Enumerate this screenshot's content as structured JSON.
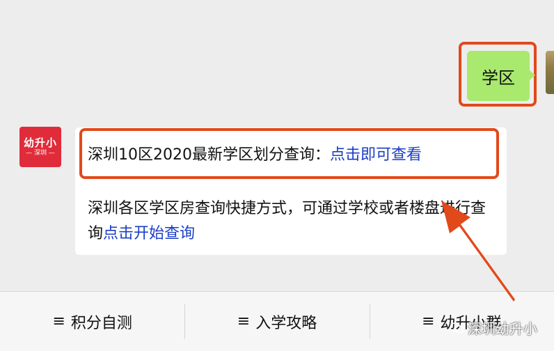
{
  "outgoing": {
    "text": "学区"
  },
  "incoming": {
    "avatar": {
      "logo_main": "幼升小",
      "logo_sub": "— 深圳 —"
    },
    "line1_text": "深圳10区2020最新学区划分查询：",
    "line1_link": "点击即可查看",
    "line2_text": "深圳各区学区房查询快捷方式，可通过学校或者楼盘进行查询",
    "line2_link": "点击开始查询"
  },
  "menu": [
    {
      "label": "积分自测"
    },
    {
      "label": "入学攻略"
    },
    {
      "label": "幼升小群"
    }
  ],
  "watermark": {
    "text": "深圳幼升小"
  },
  "colors": {
    "highlight": "#e2491a",
    "link": "#1a3ec5",
    "bubble_out": "#a9e96e",
    "avatar_bg": "#e02c3a"
  }
}
